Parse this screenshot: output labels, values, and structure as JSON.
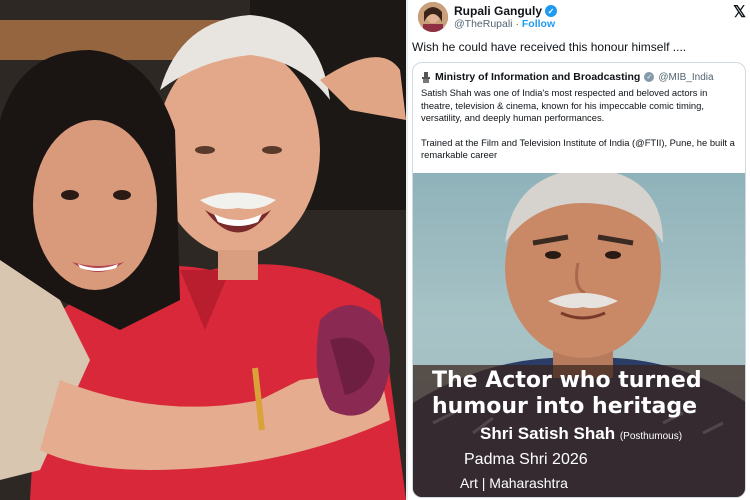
{
  "tweet": {
    "author_name": "Rupali Ganguly",
    "handle": "@TheRupali",
    "separator": "·",
    "follow_label": "Follow",
    "text": "Wish he could have received this honour himself ....",
    "platform_icon": "x-logo-icon"
  },
  "quote": {
    "author_name": "Ministry of Information and Broadcasting",
    "handle": "@MIB_India",
    "paragraph1": "Satish Shah was one of India's most respected and beloved actors in theatre, television & cinema, known for his impeccable comic timing, versatility, and deeply human performances.",
    "paragraph2": "Trained at the Film and Television Institute of India (@FTII), Pune, he built a remarkable career"
  },
  "poster": {
    "headline": "The Actor who turned humour into heritage",
    "name": "Shri Satish Shah",
    "posthumous": "(Posthumous)",
    "award": "Padma Shri 2026",
    "field": "Art | Maharashtra"
  },
  "colors": {
    "accent": "#1d9bf0",
    "text": "#0f1419",
    "muted": "#536471"
  }
}
